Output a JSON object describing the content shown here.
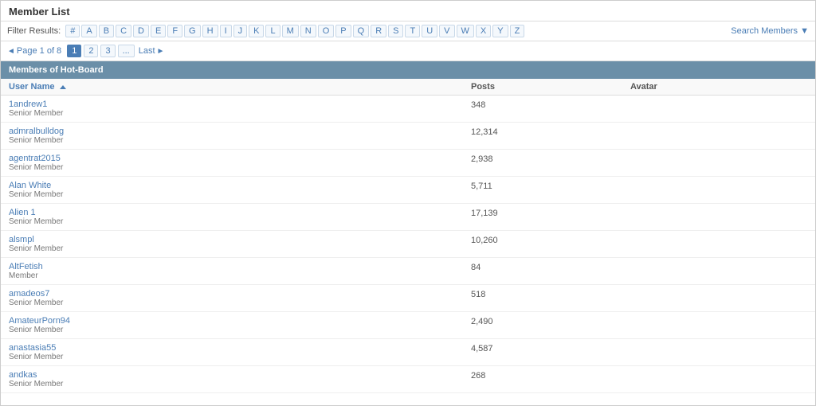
{
  "page": {
    "title": "Member List"
  },
  "filter": {
    "label": "Filter Results:",
    "letters": [
      "#",
      "A",
      "B",
      "C",
      "D",
      "E",
      "F",
      "G",
      "H",
      "I",
      "J",
      "K",
      "L",
      "M",
      "N",
      "O",
      "P",
      "Q",
      "R",
      "S",
      "T",
      "U",
      "V",
      "W",
      "X",
      "Y",
      "Z"
    ],
    "search_label": "Search Members ▼"
  },
  "pagination": {
    "first_label": "◄ Page 1 of 8",
    "pages": [
      "1",
      "2",
      "3",
      "..."
    ],
    "last_label": "Last ►"
  },
  "section_header": "Members of Hot-Board",
  "table": {
    "col_username": "User Name",
    "col_posts": "Posts",
    "col_avatar": "Avatar"
  },
  "members": [
    {
      "name": "1andrew1",
      "role": "Senior Member",
      "posts": "348"
    },
    {
      "name": "admralbulldog",
      "role": "Senior Member",
      "posts": "12,314"
    },
    {
      "name": "agentrat2015",
      "role": "Senior Member",
      "posts": "2,938"
    },
    {
      "name": "Alan White",
      "role": "Senior Member",
      "posts": "5,711"
    },
    {
      "name": "Alien 1",
      "role": "Senior Member",
      "posts": "17,139"
    },
    {
      "name": "alsmpl",
      "role": "Senior Member",
      "posts": "10,260"
    },
    {
      "name": "AltFetish",
      "role": "Member",
      "posts": "84"
    },
    {
      "name": "amadeos7",
      "role": "Senior Member",
      "posts": "518"
    },
    {
      "name": "AmateurPorn94",
      "role": "Senior Member",
      "posts": "2,490"
    },
    {
      "name": "anastasia55",
      "role": "Senior Member",
      "posts": "4,587"
    },
    {
      "name": "andkas",
      "role": "Senior Member",
      "posts": "268"
    }
  ]
}
